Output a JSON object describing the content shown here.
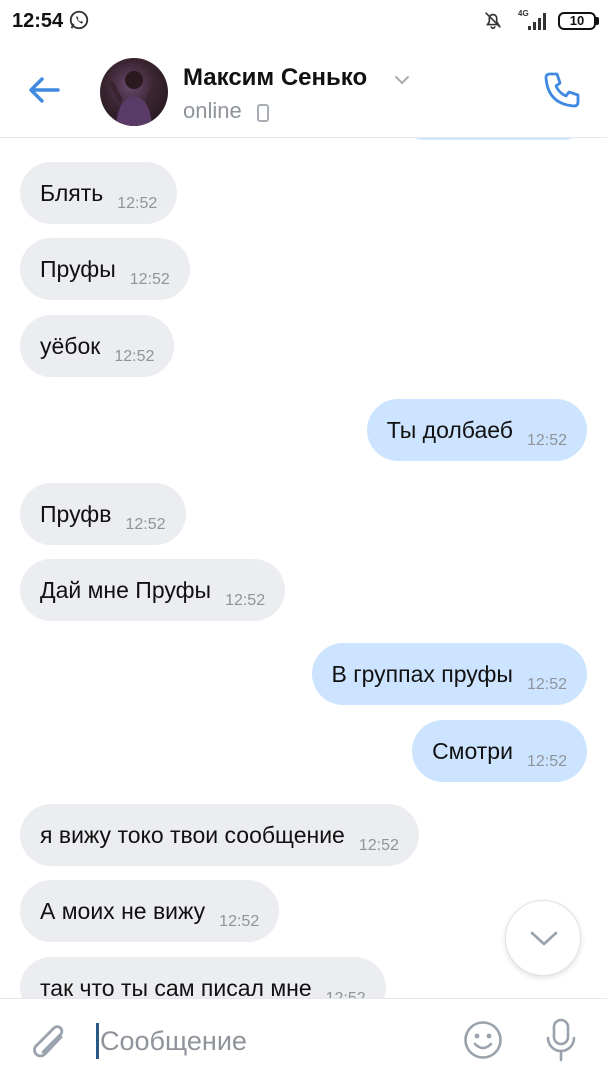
{
  "status_bar": {
    "time": "12:54",
    "network": "4G",
    "battery": "10"
  },
  "header": {
    "contact_name": "Максим Сенько",
    "status": "online"
  },
  "messages": [
    {
      "direction": "in",
      "text": "Блять",
      "time": "12:52"
    },
    {
      "direction": "in",
      "text": "Пруфы",
      "time": "12:52"
    },
    {
      "direction": "in",
      "text": "уёбок",
      "time": "12:52"
    },
    {
      "direction": "out",
      "text": "Ты долбаеб",
      "time": "12:52"
    },
    {
      "direction": "in",
      "text": "Пруфв",
      "time": "12:52"
    },
    {
      "direction": "in",
      "text": "Дай мне Пруфы",
      "time": "12:52"
    },
    {
      "direction": "out",
      "text": "В группах пруфы",
      "time": "12:52"
    },
    {
      "direction": "out",
      "text": "Смотри",
      "time": "12:52"
    },
    {
      "direction": "in",
      "text": "я вижу токо твои сообщение",
      "time": "12:52"
    },
    {
      "direction": "in",
      "text": "А моих не вижу",
      "time": "12:52"
    },
    {
      "direction": "in",
      "text": "так что ты сам писал мне",
      "time": "12:52"
    }
  ],
  "composer": {
    "placeholder": "Сообщение"
  },
  "colors": {
    "accent": "#3f8ae0",
    "incoming_bubble": "#ebedf0",
    "outgoing_bubble": "#cce4ff",
    "secondary_text": "#8f949b"
  },
  "icons": {
    "back": "arrow-left-icon",
    "call": "phone-icon",
    "chevron": "chevron-down-icon",
    "scroll_down": "chevron-down-icon",
    "attach": "paperclip-icon",
    "emoji": "smile-icon",
    "mic": "microphone-icon"
  }
}
